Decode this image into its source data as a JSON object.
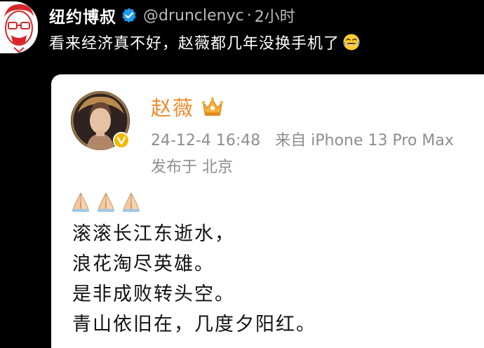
{
  "tweet": {
    "author_name": "纽约博叔",
    "handle": "@drunclenyc",
    "separator": "·",
    "time": "2小时",
    "text": "看来经济真不好，赵薇都几年没换手机了",
    "emoji": "face-with-tears-of-joy",
    "verified_color": "#1d9bf0"
  },
  "embedded_post": {
    "author_name": "赵薇",
    "name_color": "#f08a2c",
    "timestamp": "24-12-4 16:48",
    "source": "来自 iPhone 13 Pro Max",
    "location": "发布于 北京",
    "reaction_emojis": [
      "folded-hands",
      "folded-hands",
      "folded-hands"
    ],
    "lines": [
      "滚滚长江东逝水，",
      "浪花淘尽英雄。",
      "是非成败转头空。",
      "青山依旧在，几度夕阳红。"
    ]
  }
}
